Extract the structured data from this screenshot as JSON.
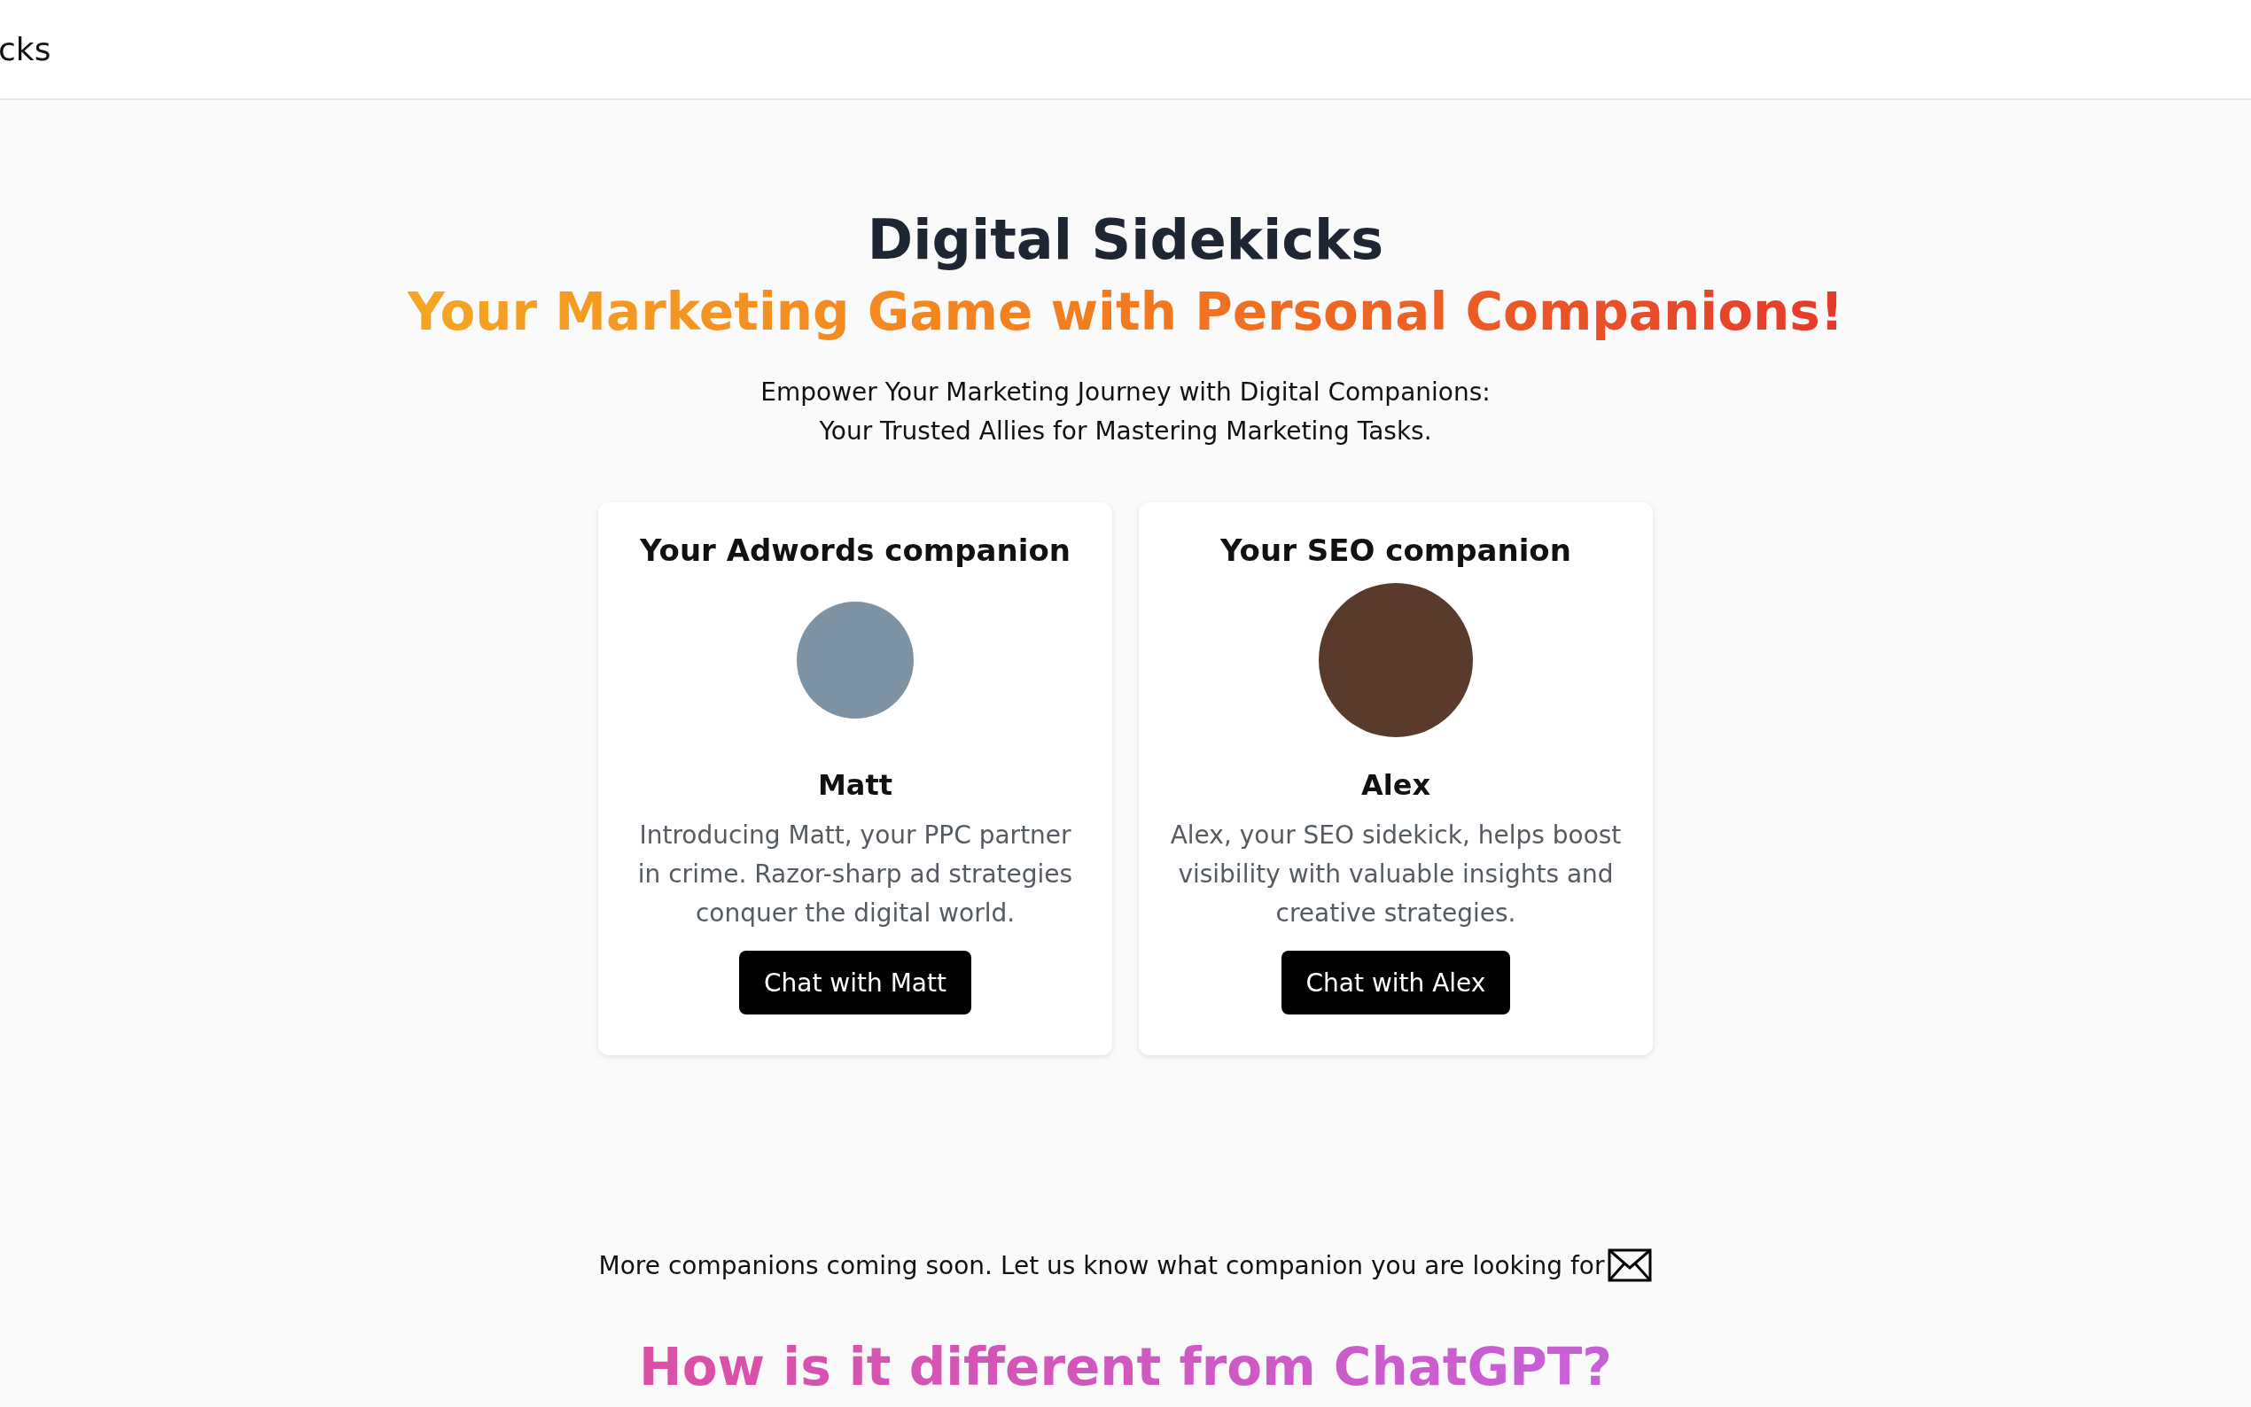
{
  "header": {
    "brand": "cks"
  },
  "hero": {
    "title": "Digital Sidekicks",
    "tagline": "Your Marketing Game with Personal Companions!",
    "intro_lines": [
      "Empower Your Marketing Journey with Digital Companions:",
      "Your Trusted Allies for Mastering Marketing Tasks."
    ]
  },
  "companions": [
    {
      "heading": "Your Adwords companion",
      "name": "Matt",
      "description": "Introducing Matt, your PPC partner in crime. Razor-sharp ad strategies conquer the digital world.",
      "button": "Chat with Matt",
      "kind": "cartoon"
    },
    {
      "heading": "Your SEO companion",
      "name": "Alex",
      "description": "Alex, your SEO sidekick, helps boost visibility with valuable insights and creative strategies.",
      "button": "Chat with Alex",
      "kind": "photo"
    }
  ],
  "footer_note": "More companions coming soon. Let us know what companion you are looking for",
  "section_heading": "How is it different from ChatGPT?"
}
